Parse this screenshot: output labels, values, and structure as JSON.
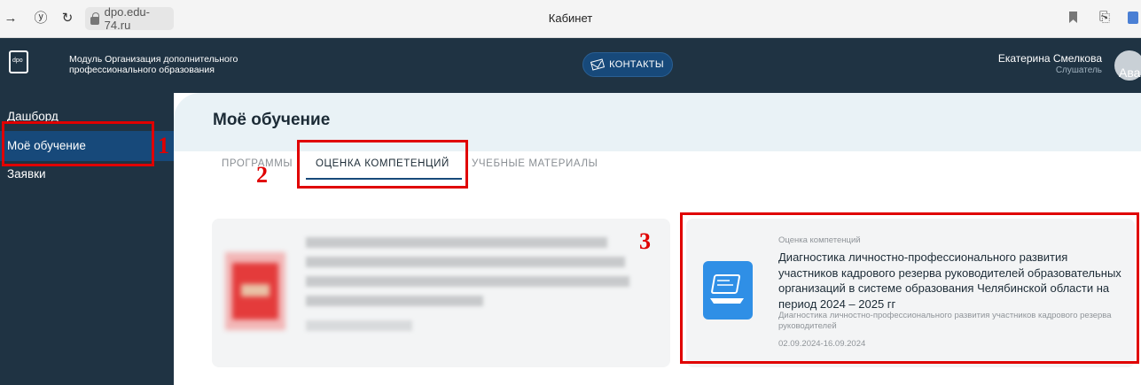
{
  "browser": {
    "url": "dpo.edu-74.ru",
    "tab_title": "Кабинет",
    "nav_forward": "→",
    "nav_yandex": "ⓨ",
    "nav_reload": "↻",
    "ext_reader": "⎘"
  },
  "header": {
    "module_title": "Модуль Организация дополнительного профессионального образования",
    "contacts_label": "КОНТАКТЫ",
    "user_name": "Екатерина Смелкова",
    "user_role": "Слушатель",
    "avatar_alt": "Ава"
  },
  "sidebar": {
    "items": [
      {
        "label": "Дашборд"
      },
      {
        "label": "Моё обучение"
      },
      {
        "label": "Заявки"
      }
    ]
  },
  "main": {
    "title": "Моё обучение",
    "tabs": [
      {
        "label": "ПРОГРАММЫ"
      },
      {
        "label": "ОЦЕНКА КОМПЕТЕНЦИЙ"
      },
      {
        "label": "УЧЕБНЫЕ МАТЕРИАЛЫ"
      }
    ],
    "card": {
      "kind": "Оценка компетенций",
      "title": "Диагностика личностно-профессионального развития участников кадрового резерва руководителей образовательных организаций в системе образования Челябинской области на период 2024 – 2025 гг",
      "description": "Диагностика личностно-профессионального развития участников кадрового резерва руководителей",
      "dates": "02.09.2024-16.09.2024"
    }
  },
  "annotations": {
    "one": "1",
    "two": "2",
    "three": "3",
    "color": "#e00000"
  },
  "colors": {
    "header_bg": "#1f3343",
    "accent": "#17497a",
    "tile_blue": "#2f8fe6"
  }
}
